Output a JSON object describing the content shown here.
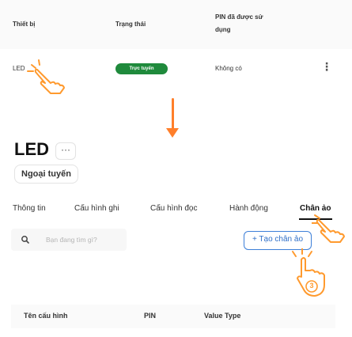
{
  "device_table": {
    "columns": [
      "Thiết bị",
      "Trạng thái",
      "PIN đã được sử dụng"
    ],
    "row": {
      "device": "LED",
      "status": "Trực tuyến",
      "pin": "Không có",
      "menu_glyph": "⋮"
    }
  },
  "device_detail": {
    "title": "LED",
    "more_glyph": "···",
    "status": "Ngoại tuyến",
    "tabs": [
      {
        "label": "Thông tin",
        "active": false
      },
      {
        "label": "Cấu hình ghi",
        "active": false
      },
      {
        "label": "Cấu hình đọc",
        "active": false
      },
      {
        "label": "Hành động",
        "active": false
      },
      {
        "label": "Chân ảo",
        "active": true
      }
    ],
    "search": {
      "placeholder": "Bạn đang tìm gì?",
      "icon": "search-icon"
    },
    "create_button": "+ Tạo chân ảo",
    "table_columns": [
      "Tên cấu hình",
      "PIN",
      "Value Type"
    ]
  },
  "annotations": {
    "arrow_color": "#ff7f2a",
    "step_badge": "3"
  },
  "colors": {
    "status_online": "#1f8a3c",
    "accent_blue": "#3d7fd8",
    "annotation_orange": "#ff9a2e"
  }
}
